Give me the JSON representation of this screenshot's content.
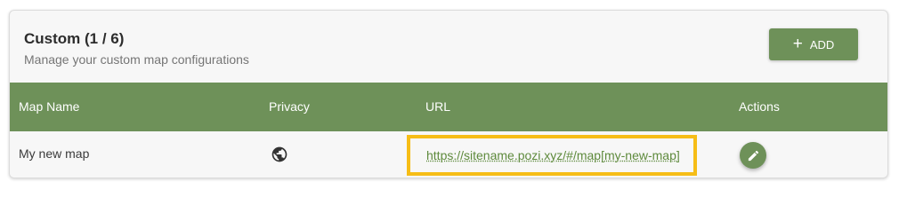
{
  "header": {
    "title": "Custom (1 / 6)",
    "subtitle": "Manage your custom map configurations",
    "add_icon": "plus-icon",
    "add_label": "ADD"
  },
  "table": {
    "columns": [
      "Map Name",
      "Privacy",
      "URL",
      "Actions"
    ],
    "rows": [
      {
        "name": "My new map",
        "privacy_icon": "globe-icon",
        "url": "https://sitename.pozi.xyz/#/map[my-new-map]",
        "action_icon": "pencil-icon"
      }
    ]
  },
  "colors": {
    "accent": "#6e9159",
    "highlight": "#f6bd16",
    "link": "#5e8a3c"
  }
}
